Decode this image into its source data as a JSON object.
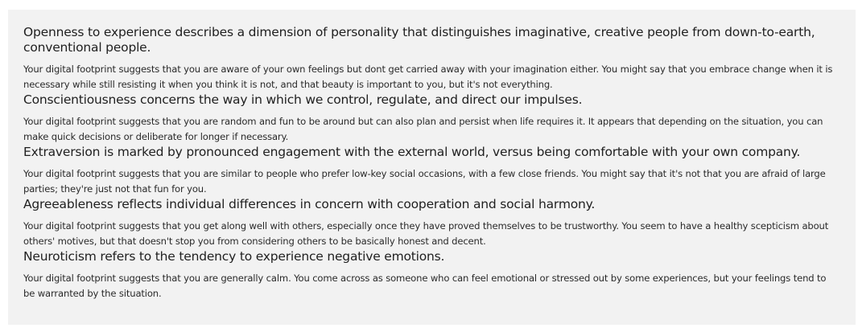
{
  "traits": [
    {
      "heading": "Openness to experience describes a dimension of personality that distinguishes imaginative, creative people from down-to-earth, conventional people.",
      "text": "Your digital footprint suggests that you are aware of your own feelings but dont get carried away with your imagination either. You might say that you embrace change when it is necessary while still resisting it when you think it is not, and that beauty is important to you, but it's not everything."
    },
    {
      "heading": "Conscientiousness concerns the way in which we control, regulate, and direct our impulses.",
      "text": "Your digital footprint suggests that you are random and fun to be around but can also plan and persist when life requires it. It appears that depending on the situation, you can make quick decisions or deliberate for longer if necessary."
    },
    {
      "heading": "Extraversion is marked by pronounced engagement with the external world, versus being comfortable with your own company.",
      "text": "Your digital footprint suggests that you are similar to people who prefer low-key social occasions, with a few close friends. You might say that it's not that you are afraid of large parties; they're just not that fun for you."
    },
    {
      "heading": "Agreeableness reflects individual differences in concern with cooperation and social harmony.",
      "text": "Your digital footprint suggests that you get along well with others, especially once they have proved themselves to be trustworthy. You seem to have a healthy scepticism about others' motives, but that doesn't stop you from considering others to be basically honest and decent."
    },
    {
      "heading": "Neuroticism refers to the tendency to experience negative emotions.",
      "text": "Your digital footprint suggests that you are generally calm. You come across as someone who can feel emotional or stressed out by some experiences, but your feelings tend to be warranted by the situation."
    }
  ]
}
